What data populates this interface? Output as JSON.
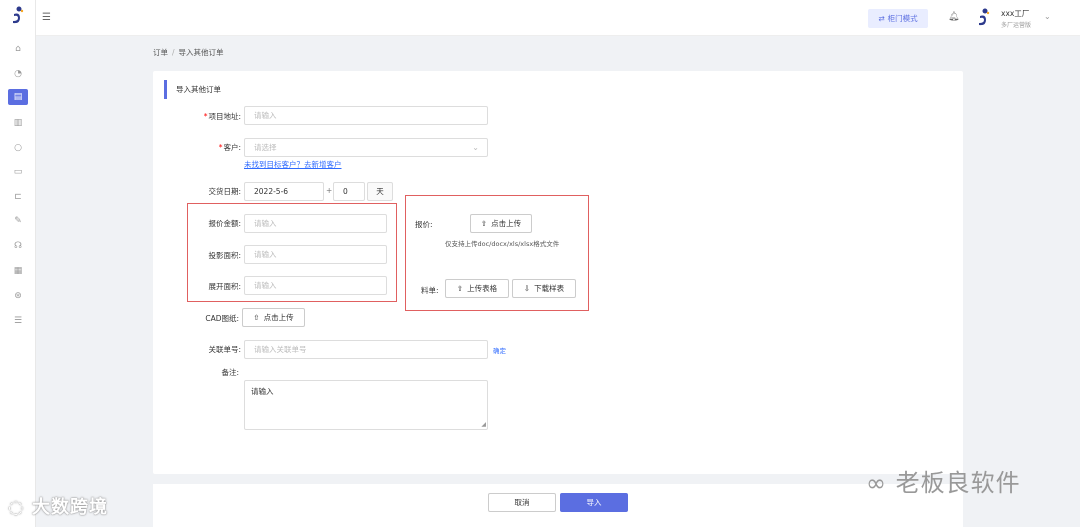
{
  "header": {
    "mode_label": "柜门模式",
    "user_name": "xxx工厂",
    "user_role": "多厂运营版"
  },
  "breadcrumb": {
    "root": "订单",
    "current": "导入其他订单"
  },
  "form": {
    "title": "导入其他订单",
    "project_address": {
      "label": "项目地址:",
      "placeholder": "请输入"
    },
    "customer": {
      "label": "客户:",
      "placeholder": "请选择",
      "link": "未找到目标客户？去新增客户"
    },
    "delivery_date": {
      "label": "交货日期:",
      "value": "2022-5-6",
      "plus": "+",
      "days": "0",
      "unit": "天"
    },
    "quote_amount": {
      "label": "报价金额:",
      "placeholder": "请输入"
    },
    "projected_area": {
      "label": "投影面积:",
      "placeholder": "请输入"
    },
    "expanded_area": {
      "label": "展开面积:",
      "placeholder": "请输入"
    },
    "quote_upload": {
      "label": "报价:",
      "button": "点击上传",
      "note": "仅支持上传doc/docx/xls/xlsx格式文件"
    },
    "materials": {
      "label": "料单:",
      "upload_button": "上传表格",
      "download_button": "下载样表"
    },
    "cad": {
      "label": "CAD图纸:",
      "button": "点击上传"
    },
    "related_order": {
      "label": "关联单号:",
      "placeholder": "请输入关联单号",
      "confirm": "确定"
    },
    "remark": {
      "label": "备注:",
      "placeholder": "请输入"
    }
  },
  "footer": {
    "cancel": "取消",
    "submit": "导入"
  },
  "watermarks": {
    "left": "大数跨境",
    "right": "老板良软件"
  },
  "colors": {
    "accent": "#5b6ee1",
    "link": "#2f6bff",
    "highlight_box": "#e06060"
  }
}
